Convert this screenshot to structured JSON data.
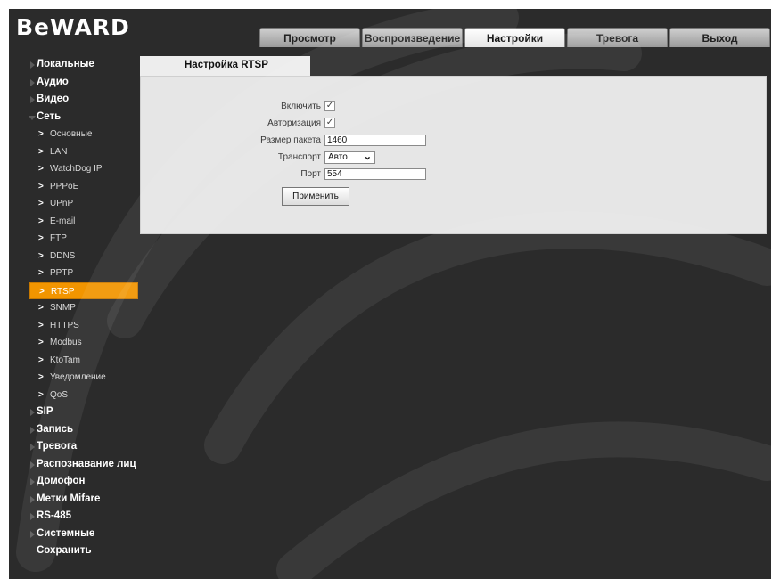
{
  "brand": {
    "logo_text": "BeWARD"
  },
  "tabs": [
    {
      "label": "Просмотр",
      "active": false
    },
    {
      "label": "Воспроизведение",
      "active": false
    },
    {
      "label": "Настройки",
      "active": true
    },
    {
      "label": "Тревога",
      "active": false
    },
    {
      "label": "Выход",
      "active": false
    }
  ],
  "sidebar": {
    "top_before": [
      {
        "label": "Локальные"
      },
      {
        "label": "Аудио"
      },
      {
        "label": "Видео"
      }
    ],
    "open_section": {
      "label": "Сеть"
    },
    "sub_items": [
      {
        "label": "Основные"
      },
      {
        "label": "LAN"
      },
      {
        "label": "WatchDog IP"
      },
      {
        "label": "PPPoE"
      },
      {
        "label": "UPnP"
      },
      {
        "label": "E-mail"
      },
      {
        "label": "FTP"
      },
      {
        "label": "DDNS"
      },
      {
        "label": "PPTP"
      },
      {
        "label": "RTSP",
        "selected": true
      },
      {
        "label": "SNMP"
      },
      {
        "label": "HTTPS"
      },
      {
        "label": "Modbus"
      },
      {
        "label": "KtoTam"
      },
      {
        "label": "Уведомление"
      },
      {
        "label": "QoS"
      }
    ],
    "top_after": [
      {
        "label": "SIP"
      },
      {
        "label": "Запись"
      },
      {
        "label": "Тревога"
      },
      {
        "label": "Распознавание лиц"
      },
      {
        "label": "Домофон"
      },
      {
        "label": "Метки Mifare"
      },
      {
        "label": "RS-485"
      },
      {
        "label": "Системные"
      }
    ],
    "save_label": "Сохранить"
  },
  "rtsp": {
    "tab_title": "Настройка RTSP",
    "enable_label": "Включить",
    "enable_checked": true,
    "auth_label": "Авторизация",
    "auth_checked": true,
    "packet_label": "Размер пакета",
    "packet_value": "1460",
    "transport_label": "Транспорт",
    "transport_value": "Авто",
    "port_label": "Порт",
    "port_value": "554",
    "apply_label": "Применить"
  },
  "colors": {
    "accent": "#f29500",
    "background": "#2b2b2b",
    "panel": "#e6e6e6"
  }
}
